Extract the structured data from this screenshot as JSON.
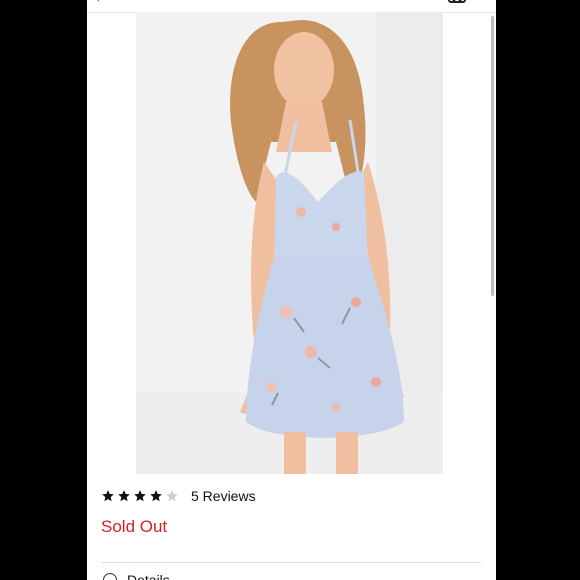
{
  "product": {
    "image_alt": "Model wearing light blue floral mini dress",
    "rating_stars": 4,
    "rating_max": 5,
    "reviews_label": "5 Reviews",
    "availability": "Sold Out",
    "details_label": "Details"
  },
  "colors": {
    "sold_out": "#d71f27",
    "dress": "#c9d6ec",
    "star_filled": "#111111",
    "star_empty": "#cfcfcf"
  },
  "icons": {
    "back": "arrow-left",
    "cart": "cart",
    "details": "circle"
  }
}
